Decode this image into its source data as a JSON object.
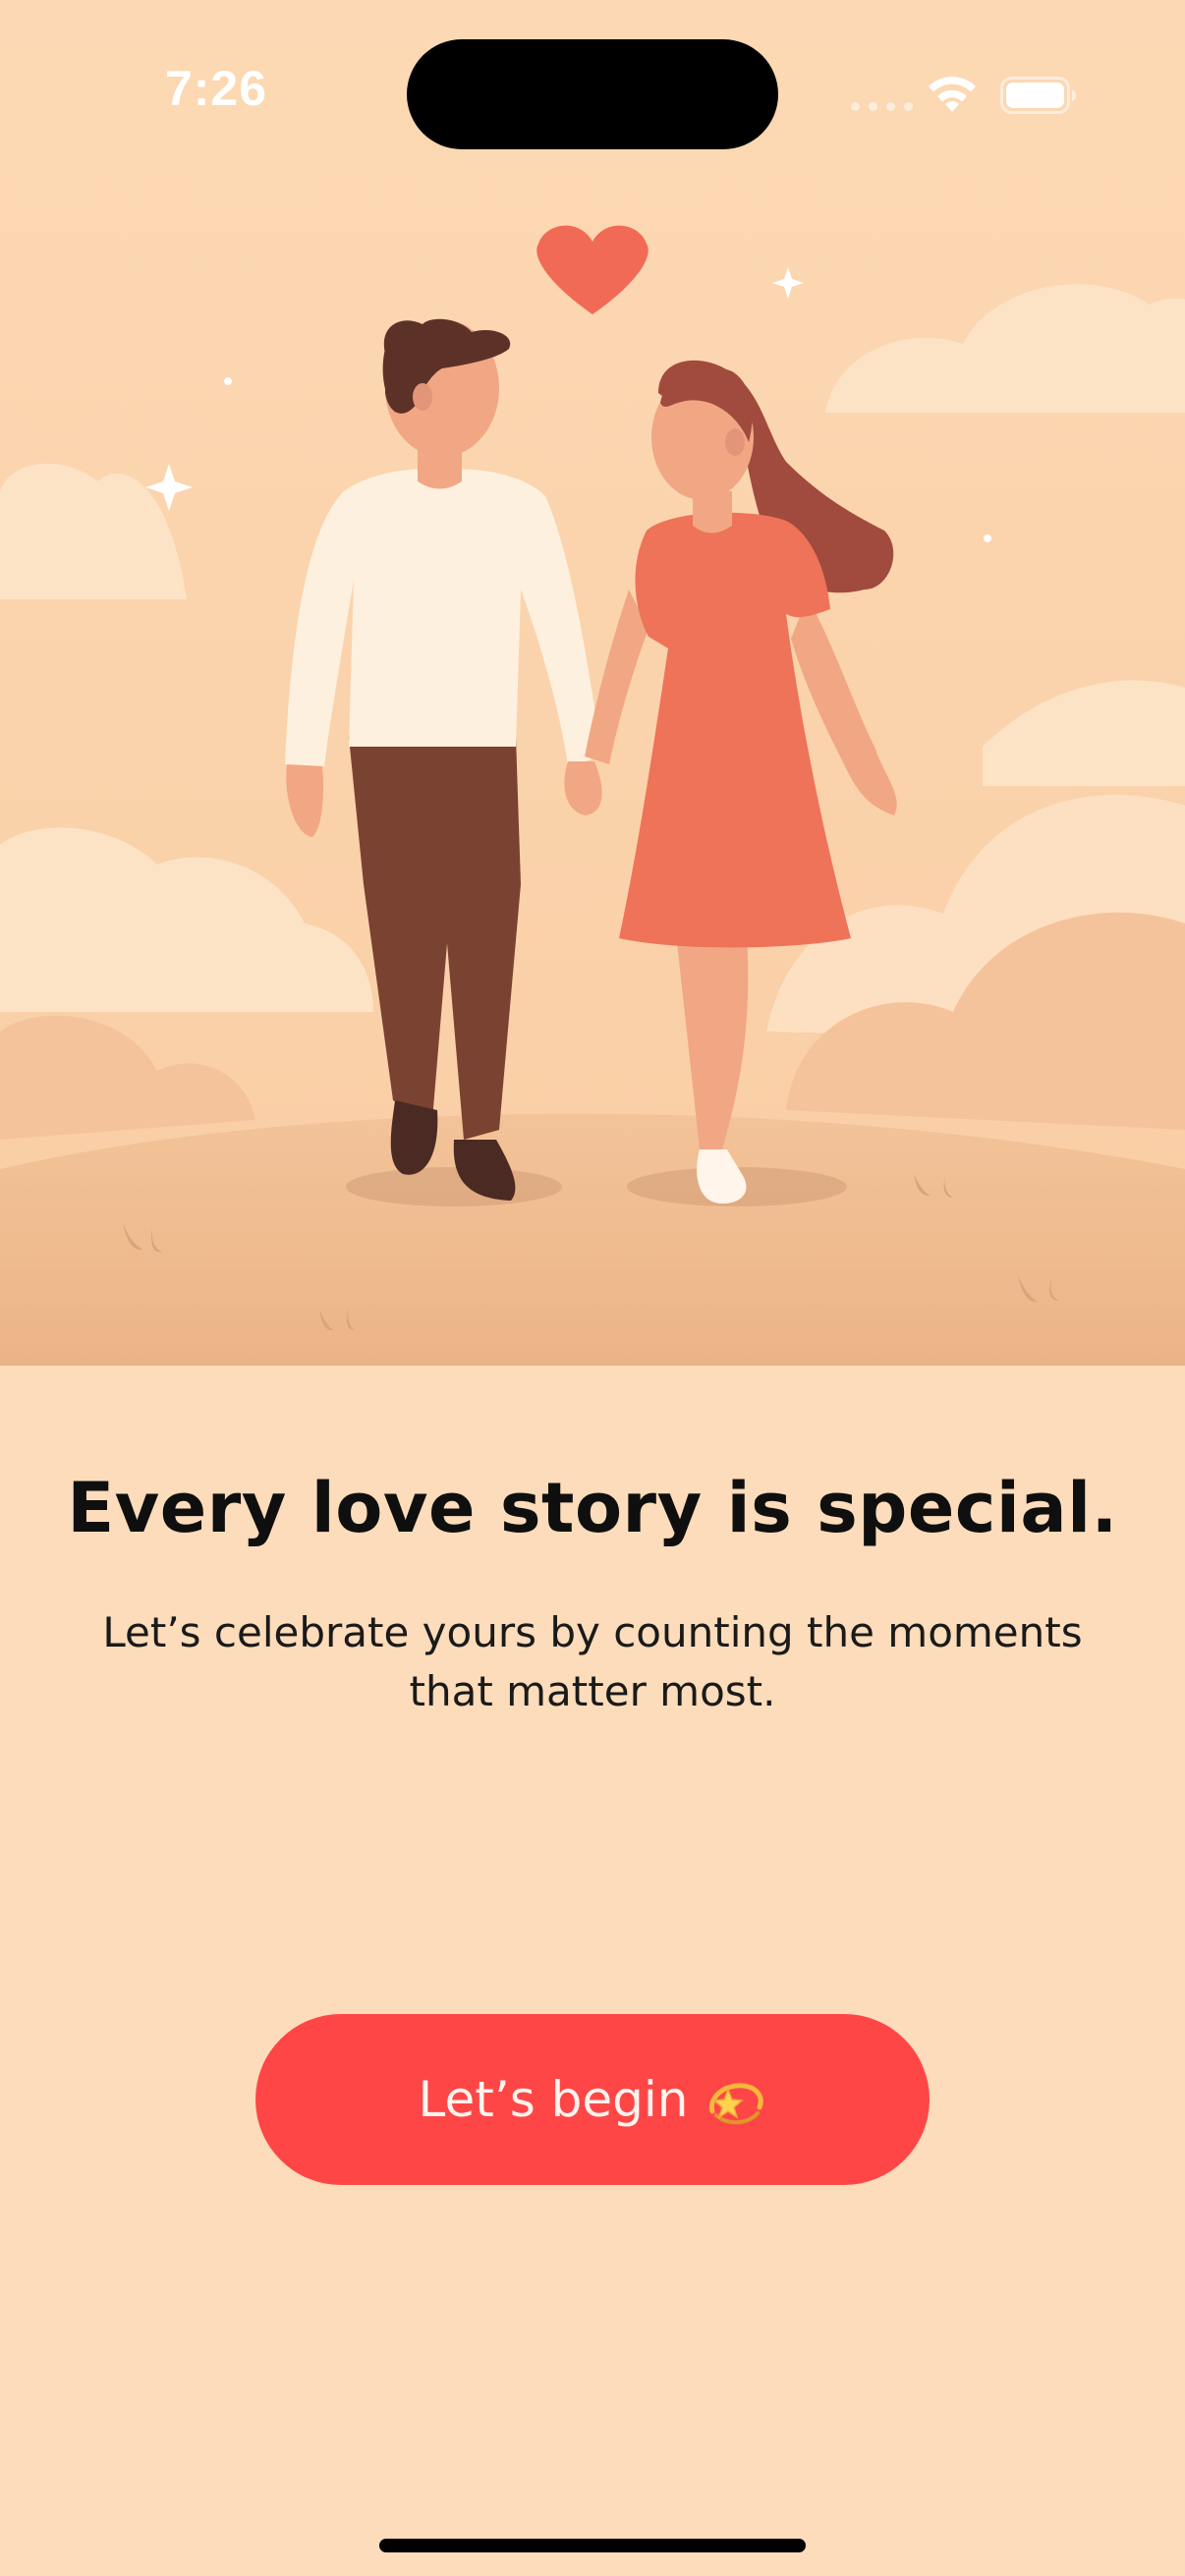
{
  "status_bar": {
    "time": "7:26",
    "icons": [
      "signal-icon",
      "wifi-icon",
      "battery-icon"
    ]
  },
  "hero": {
    "image": "couple-holding-hands-illustration",
    "icons": [
      "heart-icon",
      "sparkle-icon"
    ]
  },
  "onboarding": {
    "title": "Every love story is special.",
    "subtitle": "Let’s celebrate yours by counting the moments that matter most.",
    "cta_label": "Let’s begin",
    "cta_icon": "dizzy-star-icon"
  },
  "colors": {
    "background": "#FCDCBA",
    "accent": "#FF4646",
    "dress": "#EE7358",
    "ground": "#EDB888",
    "heart": "#F16A55"
  }
}
